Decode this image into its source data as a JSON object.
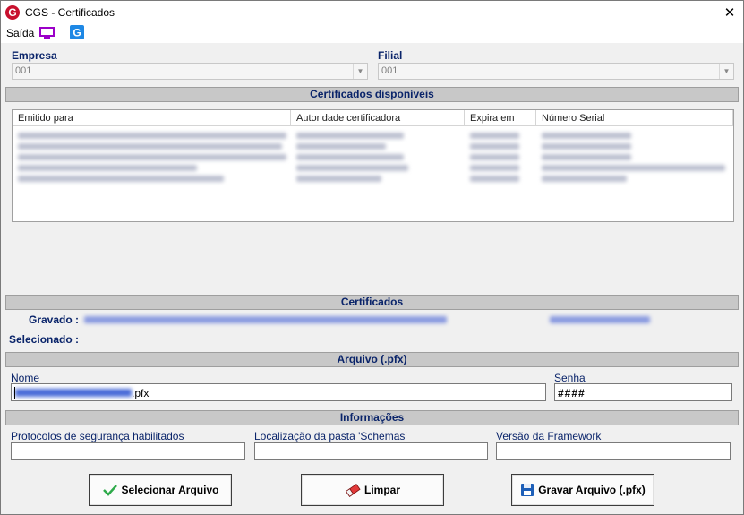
{
  "window": {
    "title": "CGS - Certificados",
    "close": "✕"
  },
  "menubar": {
    "label": "Saída"
  },
  "empresa": {
    "label": "Empresa",
    "value": "001"
  },
  "filial": {
    "label": "Filial",
    "value": "001"
  },
  "sections": {
    "disponiveis": "Certificados disponíveis",
    "certificados": "Certificados",
    "arquivo": "Arquivo (.pfx)",
    "informacoes": "Informações"
  },
  "list": {
    "columns": [
      "Emitido para",
      "Autoridade certificadora",
      "Expira em",
      "Número Serial"
    ]
  },
  "certificados": {
    "gravado_label": "Gravado :",
    "selecionado_label": "Selecionado :"
  },
  "arquivo": {
    "nome_label": "Nome",
    "nome_suffix": ".pfx",
    "senha_label": "Senha",
    "senha_value": "####"
  },
  "informacoes": {
    "protocolos_label": "Protocolos de segurança habilitados",
    "schemas_label": "Localização da pasta 'Schemas'",
    "framework_label": "Versão da Framework"
  },
  "buttons": {
    "selecionar": "Selecionar Arquivo",
    "limpar": "Limpar",
    "gravar": "Gravar Arquivo (.pfx)"
  }
}
